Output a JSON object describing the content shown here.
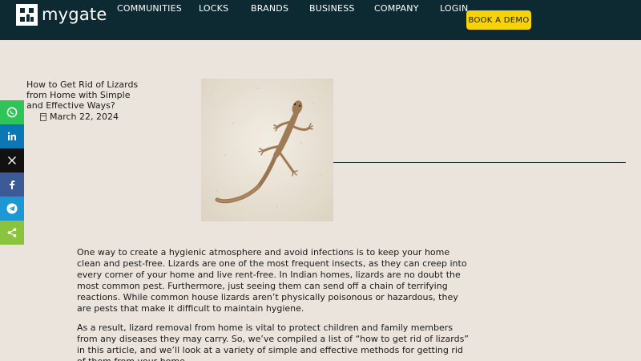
{
  "header": {
    "logo_text": "mygate",
    "nav": [
      "COMMUNITIES",
      "LOCKS",
      "BRANDS",
      "BUSINESS",
      "COMPANY",
      "LOGIN"
    ],
    "cta_label": "BOOK A DEMO",
    "colors": {
      "bar": "#0d2a33",
      "cta": "#f5d20c"
    }
  },
  "share_bar": [
    {
      "icon": "whatsapp-icon",
      "color": "#2fc457"
    },
    {
      "icon": "linkedin-icon",
      "color": "#0a78b5"
    },
    {
      "icon": "x-icon",
      "color": "#111111"
    },
    {
      "icon": "facebook-icon",
      "color": "#3d5a98"
    },
    {
      "icon": "telegram-icon",
      "color": "#1e98d4"
    },
    {
      "icon": "share-icon",
      "color": "#8ac43f"
    }
  ],
  "article": {
    "title": "How to Get Rid of Lizards from Home with Simple and Effective Ways?",
    "date": "March 22, 2024",
    "paragraphs": [
      "One way to create a hygienic atmosphere and avoid infections is to keep your home clean and pest-free. Lizards are one of the most frequent insects, as they can creep into every corner of your home and live rent-free. In Indian homes, lizards are no doubt the most common pest. Furthermore, just seeing them can send off a chain of terrifying reactions. While common house lizards aren’t physically poisonous or hazardous, they are pests that make it difficult to maintain hygiene.",
      "As a result, lizard removal from home is vital to protect children and family members from any diseases they may carry. So, we’ve compiled a list of “how to get rid of lizards” in this article, and we’ll look at a variety of simple and effective methods for getting rid of them from your home."
    ]
  }
}
